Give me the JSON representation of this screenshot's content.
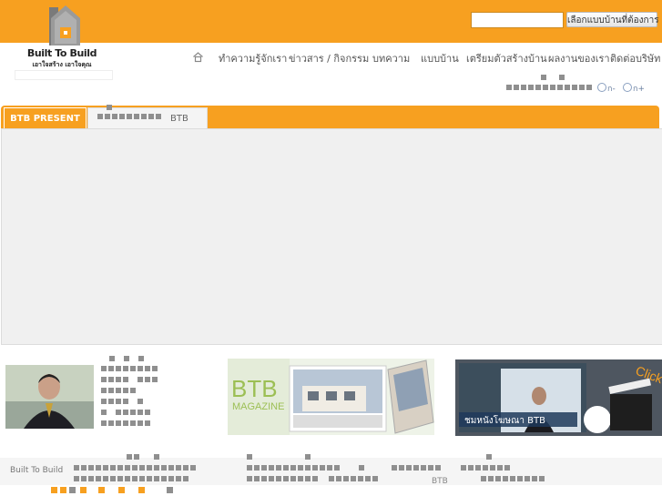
{
  "header": {
    "logo_title": "Built To Build",
    "logo_tagline": "เอาใจสร้าง เอาใจคุณ",
    "search_placeholder": "",
    "search_button": "เลือกแบบบ้านที่ต้องการ",
    "brand_color": "#f7a020"
  },
  "nav": {
    "home_icon": "home-icon",
    "items": [
      "ทำความรู้จักเรา",
      "ข่าวสาร / กิจกรรม",
      "บทความ",
      "แบบบ้าน",
      "เตรียมตัวสร้างบ้าน",
      "ผลงานของเรา",
      "ติดต่อบริษัท"
    ]
  },
  "font_tools": {
    "decrease": "ก-",
    "increase": "ก+"
  },
  "tabs": [
    {
      "label": "BTB PRESENT",
      "active": true
    },
    {
      "label": "BTB",
      "active": false
    }
  ],
  "promos": {
    "magazine": {
      "brand": "BTB",
      "sub": "MAGAZINE"
    },
    "video": {
      "caption": "ชมหนังโฆษณา BTB",
      "badge": "Click"
    }
  },
  "footer": {
    "brand": "Built To Build",
    "small": "BTB",
    "dot_colors": [
      "#f7a020",
      "#f7a020",
      "#8f8f8f",
      "#f7a020",
      "#f7a020",
      "#f7a020",
      "#f7a020",
      "#8f8f8f"
    ]
  }
}
